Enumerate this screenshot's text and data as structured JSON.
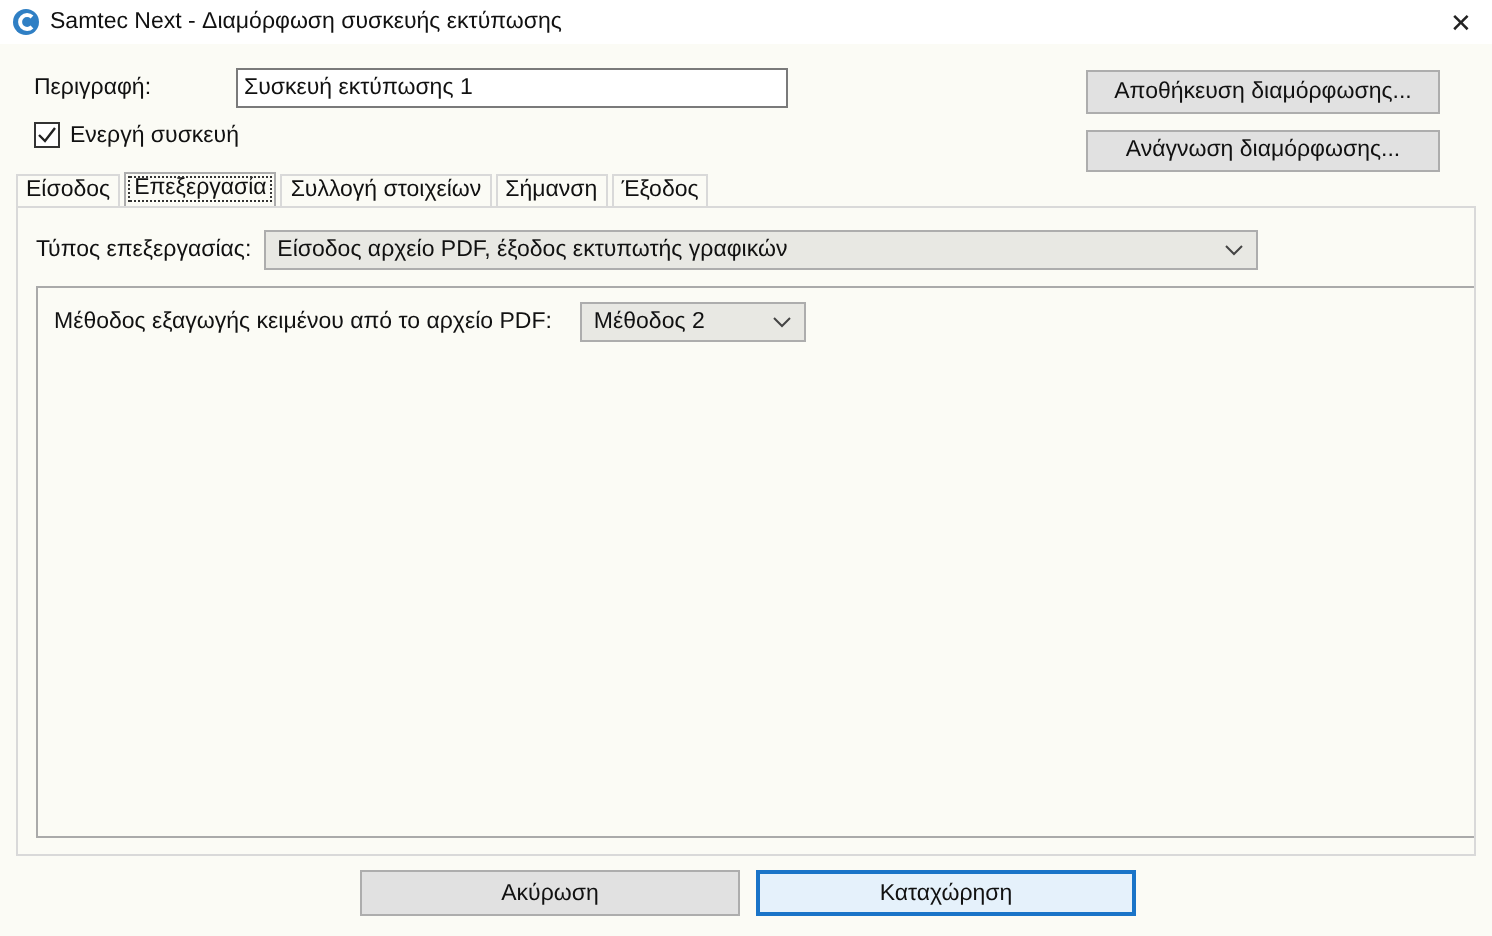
{
  "window": {
    "title": "Samtec Next - Διαμόρφωση συσκευής εκτύπωσης",
    "close": "✕"
  },
  "description": {
    "label": "Περιγραφή:",
    "value": "Συσκευή εκτύπωσης 1"
  },
  "active_device": {
    "label": "Ενεργή συσκευή",
    "checked": true
  },
  "side_buttons": [
    "Αποθήκευση διαμόρφωσης...",
    "Ανάγνωση διαμόρφωσης..."
  ],
  "tabs": [
    {
      "label": "Είσοδος",
      "selected": false
    },
    {
      "label": "Επεξεργασία",
      "selected": true
    },
    {
      "label": "Συλλογή στοιχείων",
      "selected": false
    },
    {
      "label": "Σήμανση",
      "selected": false
    },
    {
      "label": "Έξοδος",
      "selected": false
    }
  ],
  "processing_type": {
    "label": "Τύπος επεξεργασίας:",
    "value": "Είσοδος αρχείο PDF, έξοδος εκτυπωτής γραφικών"
  },
  "extraction_method": {
    "label": "Μέθοδος εξαγωγής κειμένου από το αρχείο PDF:",
    "value": "Μέθοδος 2"
  },
  "buttons": [
    {
      "label": "Ακύρωση",
      "default": false
    },
    {
      "label": "Καταχώρηση",
      "default": true
    }
  ]
}
